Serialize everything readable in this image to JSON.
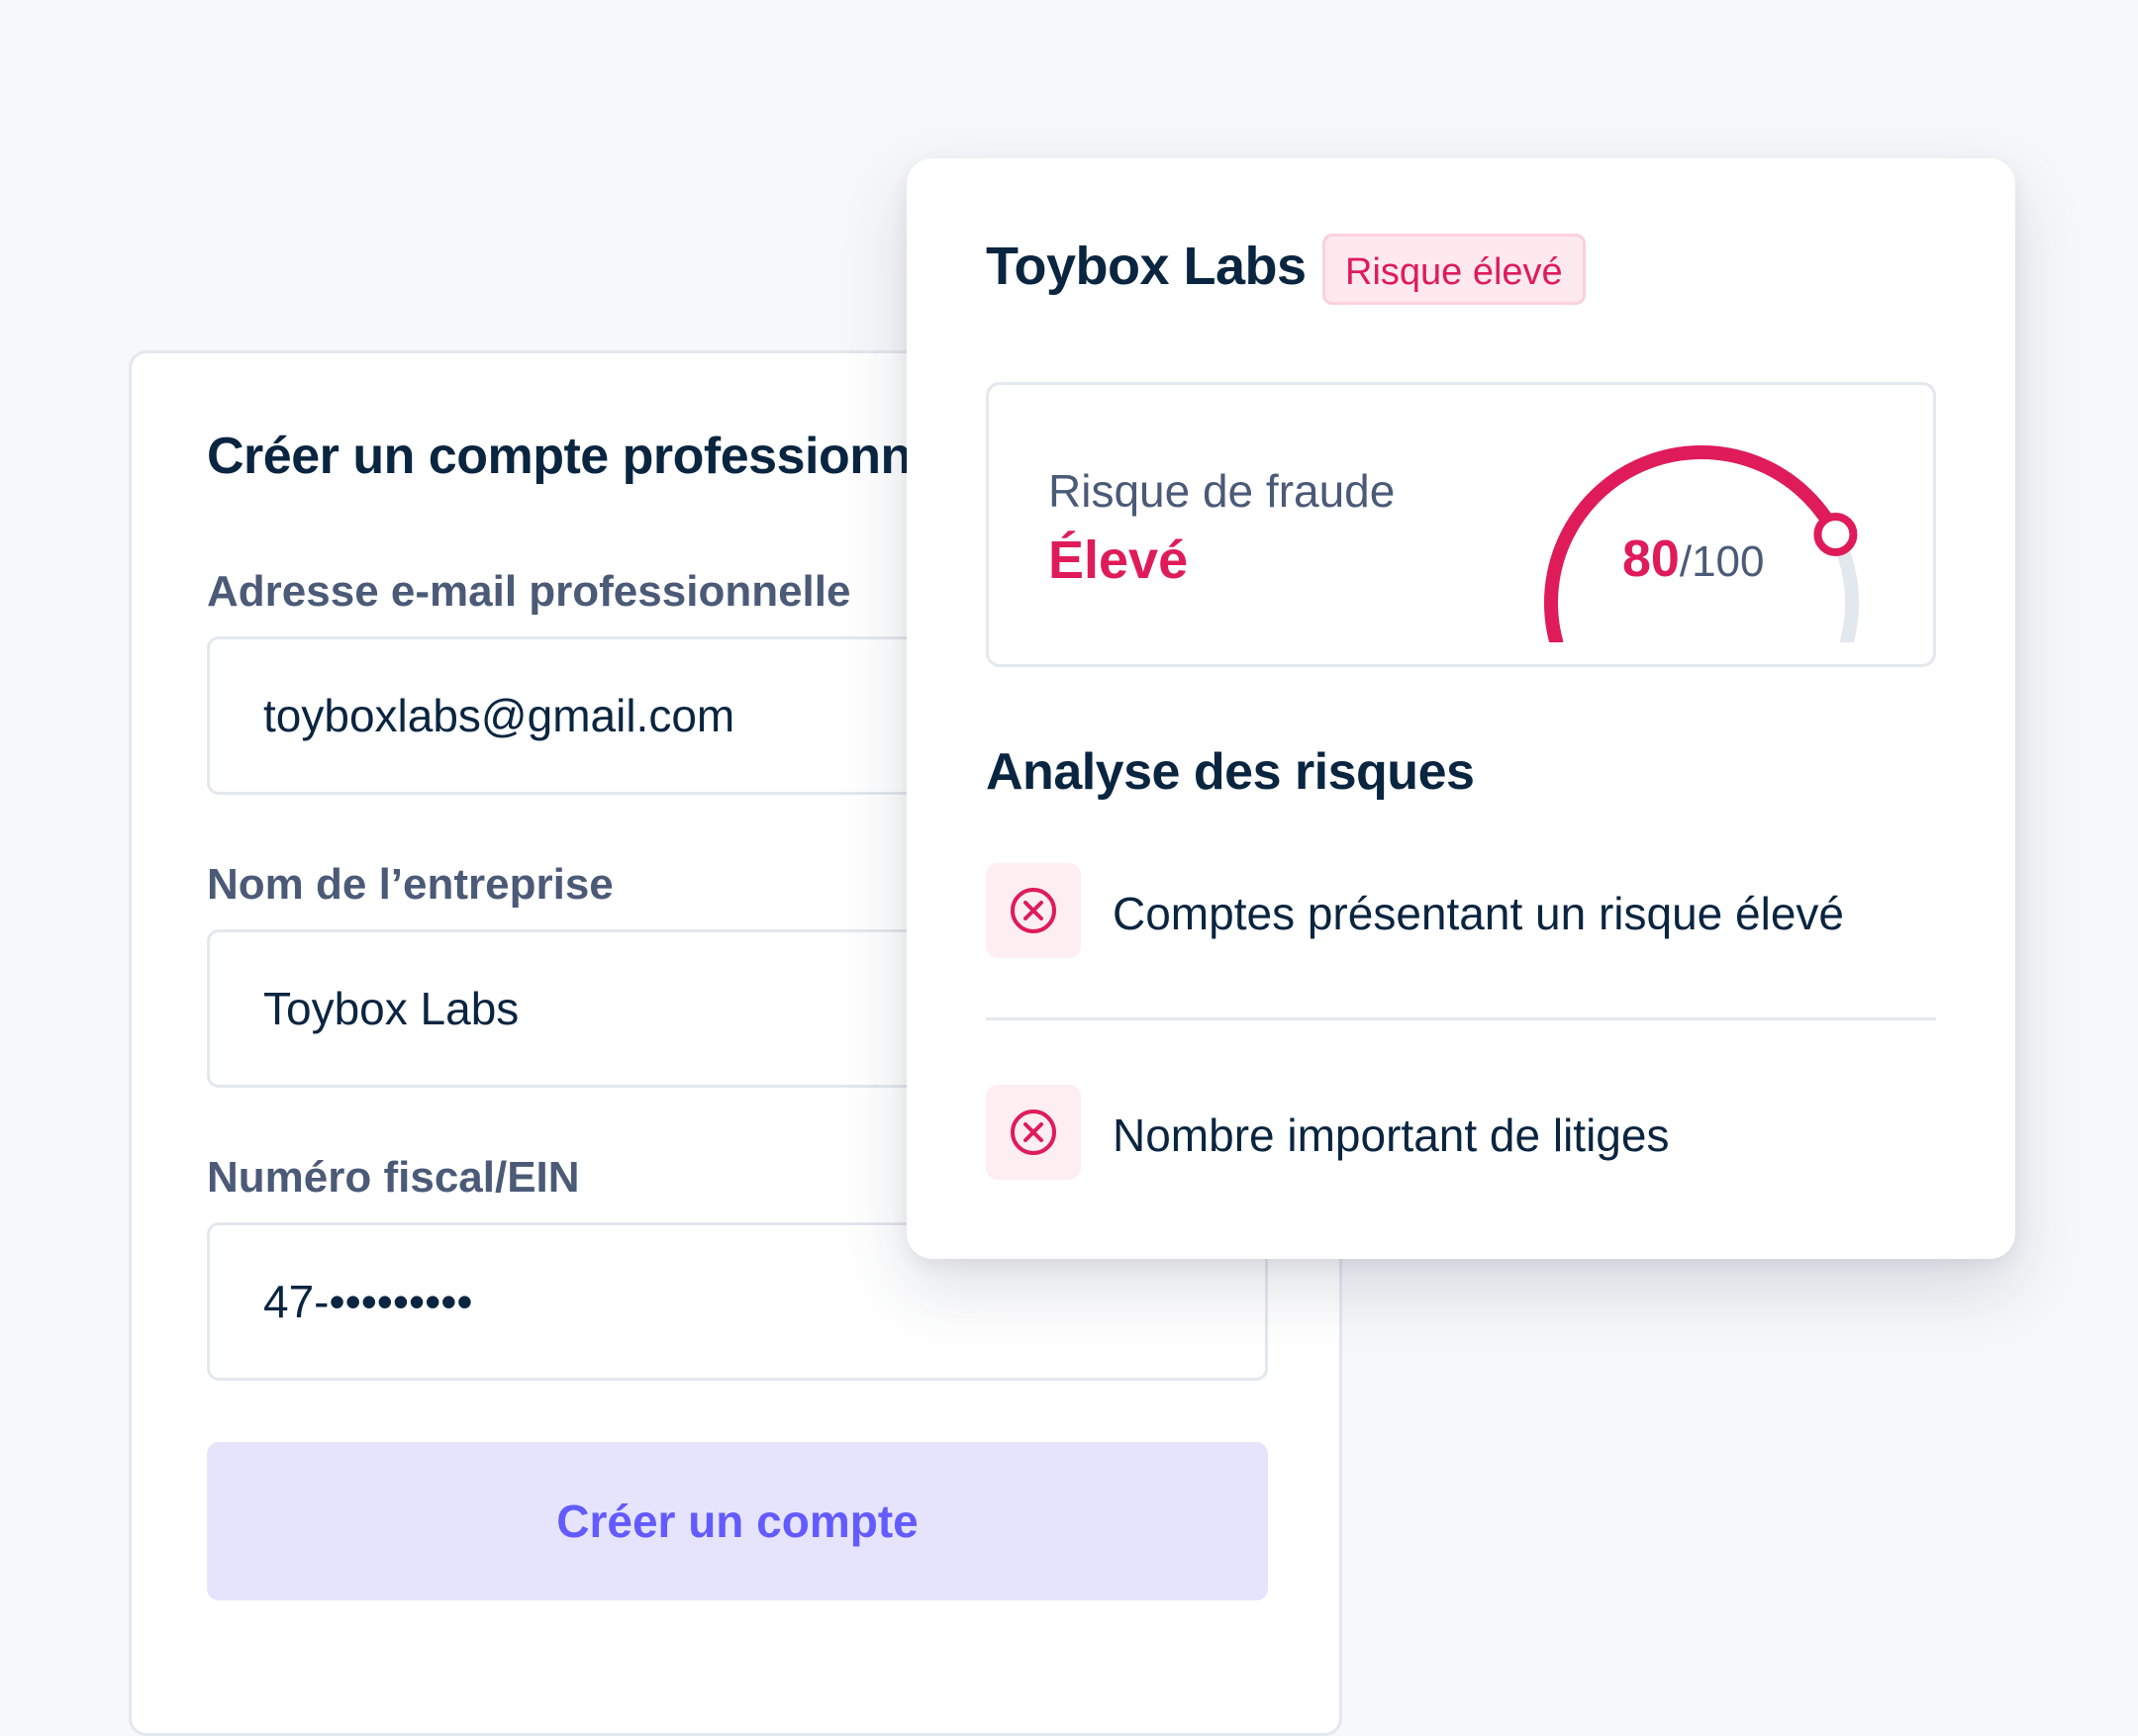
{
  "form": {
    "title": "Créer un compte professionnel",
    "fields": [
      {
        "label": "Adresse e-mail professionnelle",
        "value": "toyboxlabs@gmail.com"
      },
      {
        "label": "Nom de l’entreprise",
        "value": "Toybox Labs"
      },
      {
        "label": "Numéro fiscal/EIN",
        "value": "47-•••••••••"
      }
    ],
    "submit_label": "Créer un compte"
  },
  "risk_panel": {
    "company": "Toybox Labs",
    "badge": "Risque élevé",
    "fraud_risk": {
      "label": "Risque de fraude",
      "level": "Élevé",
      "score": 80,
      "score_display": "80",
      "max_display": "/100"
    },
    "analysis_title": "Analyse des risques",
    "items": [
      {
        "icon": "x-circle-icon",
        "text": "Comptes présentant un risque élevé"
      },
      {
        "icon": "x-circle-icon",
        "text": "Nombre important de litiges"
      }
    ]
  },
  "colors": {
    "background": "#f6f8fa",
    "text_dark": "#0a2540",
    "text_muted": "#4b5a77",
    "risk_accent": "#df1b5a",
    "button_bg": "#e6e4fd",
    "button_text": "#635bff",
    "border": "#e3e8ee"
  }
}
